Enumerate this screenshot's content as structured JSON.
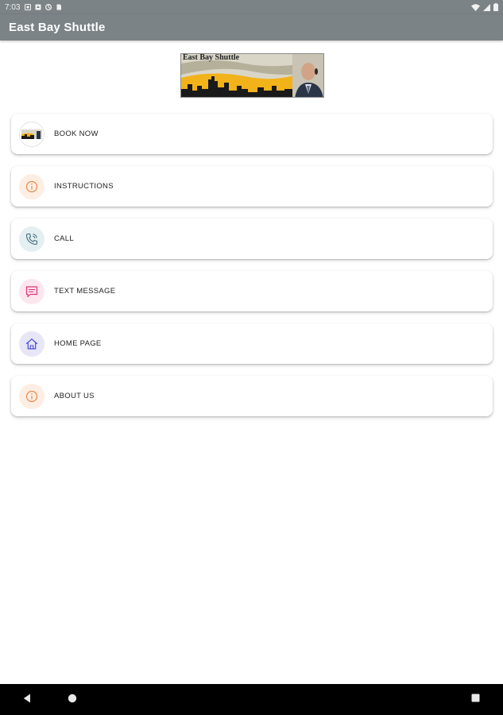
{
  "status_bar": {
    "time": "7:03",
    "icons": [
      "notification-icon",
      "notification-icon",
      "data-saver-icon",
      "sim-icon"
    ],
    "right_icons": [
      "wifi-icon",
      "signal-icon",
      "battery-icon"
    ]
  },
  "app_bar": {
    "title": "East Bay Shuttle",
    "color": "#7c8387"
  },
  "logo": {
    "text": "East Bay Shuttle"
  },
  "menu": {
    "items": [
      {
        "label": "BOOK NOW",
        "icon": "booking-thumbnail-icon",
        "color": "#c9a227"
      },
      {
        "label": "INSTRUCTIONS",
        "icon": "info-icon",
        "color": "#e8884a"
      },
      {
        "label": "CALL",
        "icon": "phone-icon",
        "color": "#3f6c7a"
      },
      {
        "label": "TEXT MESSAGE",
        "icon": "message-icon",
        "color": "#e2347a"
      },
      {
        "label": "HOME PAGE",
        "icon": "home-icon",
        "color": "#4a4ad6"
      },
      {
        "label": "ABOUT US",
        "icon": "info-icon",
        "color": "#e8884a"
      }
    ]
  },
  "nav_bar": {
    "buttons": [
      "back-icon",
      "home-icon",
      "recents-icon"
    ]
  }
}
